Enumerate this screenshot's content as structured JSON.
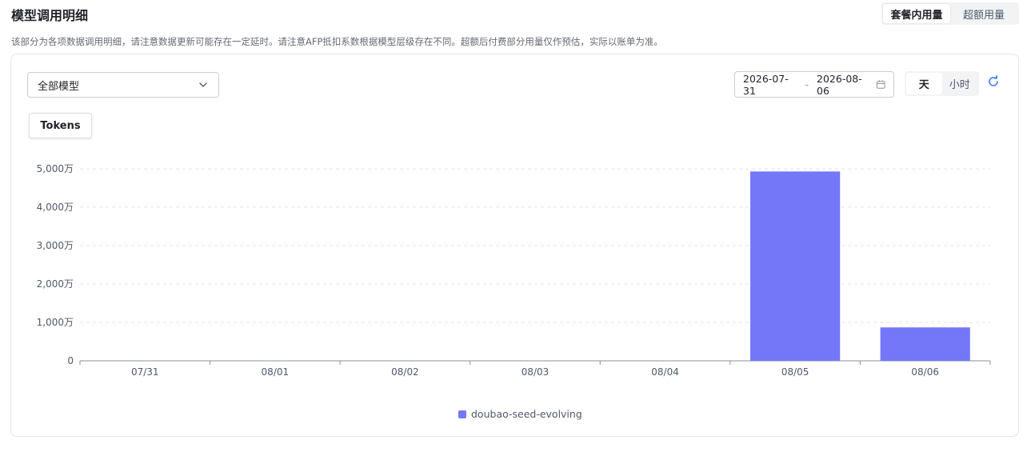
{
  "header": {
    "title": "模型调用明细",
    "view_tabs": [
      {
        "label": "套餐内用量",
        "active": true
      },
      {
        "label": "超额用量",
        "active": false
      }
    ]
  },
  "description": "该部分为各项数据调用明细，请注意数据更新可能存在一定延时。请注意AFP抵扣系数根据模型层级存在不同。超额后付费部分用量仅作预估，实际以账单为准。",
  "filters": {
    "model_select": {
      "value": "全部模型"
    },
    "date_range": {
      "start": "2026-07-31",
      "separator": "-",
      "end": "2026-08-06"
    },
    "granularity": [
      {
        "label": "天",
        "active": true
      },
      {
        "label": "小时",
        "active": false
      }
    ],
    "icons": {
      "caret": "chevron-down-icon",
      "calendar": "calendar-icon",
      "refresh": "refresh-icon"
    }
  },
  "metric_tab": {
    "label": "Tokens"
  },
  "colors": {
    "accent": "#3370ff",
    "bar": "#7477f7"
  },
  "chart_data": {
    "type": "bar",
    "categories": [
      "07/31",
      "08/01",
      "08/02",
      "08/03",
      "08/04",
      "08/05",
      "08/06"
    ],
    "series": [
      {
        "name": "doubao-seed-evolving",
        "values": [
          0,
          0,
          0,
          0,
          0,
          4930,
          870
        ]
      }
    ],
    "ylim": [
      0,
      5000
    ],
    "y_ticks": [
      {
        "value": 0,
        "label": "0"
      },
      {
        "value": 1000,
        "label": "1,000万"
      },
      {
        "value": 2000,
        "label": "2,000万"
      },
      {
        "value": 3000,
        "label": "3,000万"
      },
      {
        "value": 4000,
        "label": "4,000万"
      },
      {
        "value": 5000,
        "label": "5,000万"
      }
    ],
    "grid": true,
    "legend": "bottom-center"
  }
}
